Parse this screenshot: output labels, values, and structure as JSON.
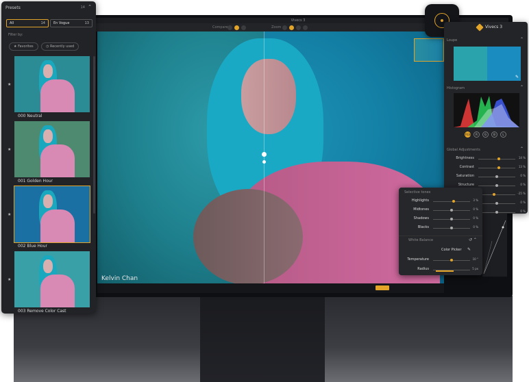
{
  "app": {
    "window_title": "Vivecs 3",
    "toolbar": {
      "compare_label": "Compare",
      "zoom_label": "Zoom"
    },
    "credit": "Kelvin Chan"
  },
  "presets_panel": {
    "title": "Presets",
    "count": "14",
    "tabs": [
      {
        "label": "All",
        "count": "14"
      },
      {
        "label": "En Vogue",
        "count": "13"
      }
    ],
    "filter_label": "Filter by:",
    "filters": [
      {
        "label": "Favorites",
        "icon": "star-icon"
      },
      {
        "label": "Recently used",
        "icon": "clock-icon"
      }
    ],
    "items": [
      {
        "label": "000 Neutral",
        "tint": "#2c8c95"
      },
      {
        "label": "001 Golden Hour",
        "tint": "#4e8a70"
      },
      {
        "label": "002 Blue Hour",
        "tint": "#1a6fa3"
      },
      {
        "label": "003 Remove Color Cast",
        "tint": "#3aa0a8"
      }
    ]
  },
  "right_panel": {
    "app_name": "Vivecs 3",
    "sections": {
      "loupe": "Loupe",
      "histogram": "Histogram",
      "global": "Global Adjustments"
    },
    "channels": [
      "RGB",
      "R",
      "G",
      "B",
      "L"
    ],
    "adjustments": [
      {
        "label": "Brightness",
        "value": "14 %",
        "pos": 0.55,
        "active": true
      },
      {
        "label": "Contrast",
        "value": "13 %",
        "pos": 0.55,
        "active": true
      },
      {
        "label": "Saturation",
        "value": "0 %",
        "pos": 0.5,
        "active": false
      },
      {
        "label": "Structure",
        "value": "0 %",
        "pos": 0.5,
        "active": false
      },
      {
        "label": "",
        "value": "-25 %",
        "pos": 0.42,
        "active": true
      },
      {
        "label": "",
        "value": "0 %",
        "pos": 0.5,
        "active": false
      },
      {
        "label": "",
        "value": "0 %",
        "pos": 0.5,
        "active": false
      }
    ]
  },
  "selective_panel": {
    "title": "Selective tones",
    "tones": [
      {
        "label": "Highlights",
        "value": "3 %",
        "pos": 0.55,
        "active": true
      },
      {
        "label": "Midtones",
        "value": "0 %",
        "pos": 0.5,
        "active": false
      },
      {
        "label": "Shadows",
        "value": "0 %",
        "pos": 0.5,
        "active": false
      },
      {
        "label": "Blacks",
        "value": "0 %",
        "pos": 0.5,
        "active": false
      }
    ],
    "white_balance": "White Balance",
    "color_picker": "Color Picker",
    "temperature": {
      "label": "Temperature",
      "value": "10 °",
      "pos": 0.5
    },
    "radius": {
      "label": "Radius",
      "value": "5 px",
      "fill": 0.48
    }
  },
  "colors": {
    "accent": "#e3a42a",
    "panel": "#232428"
  }
}
